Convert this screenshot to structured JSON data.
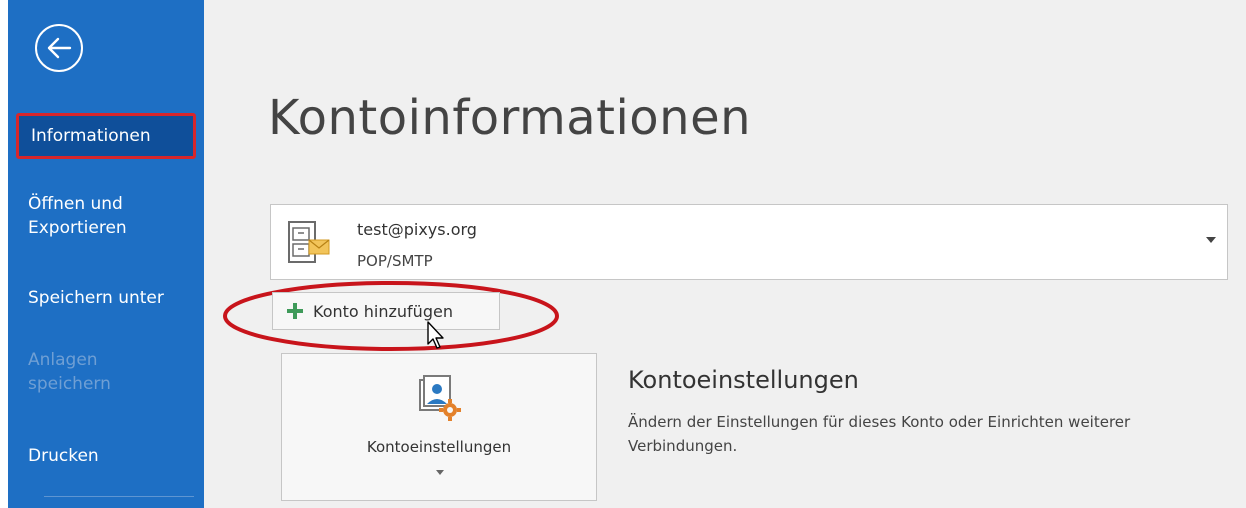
{
  "sidebar": {
    "items": [
      {
        "label": "Informationen",
        "selected": true
      },
      {
        "label": "Öffnen und Exportieren"
      },
      {
        "label": "Speichern unter"
      },
      {
        "label": "Anlagen speichern",
        "disabled": true
      },
      {
        "label": "Drucken"
      }
    ]
  },
  "page": {
    "title": "Kontoinformationen"
  },
  "account": {
    "email": "test@pixys.org",
    "type": "POP/SMTP",
    "add_button_label": "Konto hinzufügen"
  },
  "settings": {
    "tile_label": "Kontoeinstellungen",
    "heading": "Kontoeinstellungen",
    "description": "Ändern der Einstellungen für dieses Konto oder Einrichten weiterer Verbindungen."
  },
  "colors": {
    "sidebar_bg": "#1e6fc4",
    "selected_bg": "#0f4f9a",
    "highlight_red": "#d7262b",
    "main_bg": "#f0f0f0"
  },
  "icons": [
    "back-arrow-icon",
    "account-file-icon",
    "dropdown-arrow-icon",
    "plus-icon",
    "account-settings-icon",
    "caret-down-icon",
    "mouse-cursor-icon"
  ]
}
